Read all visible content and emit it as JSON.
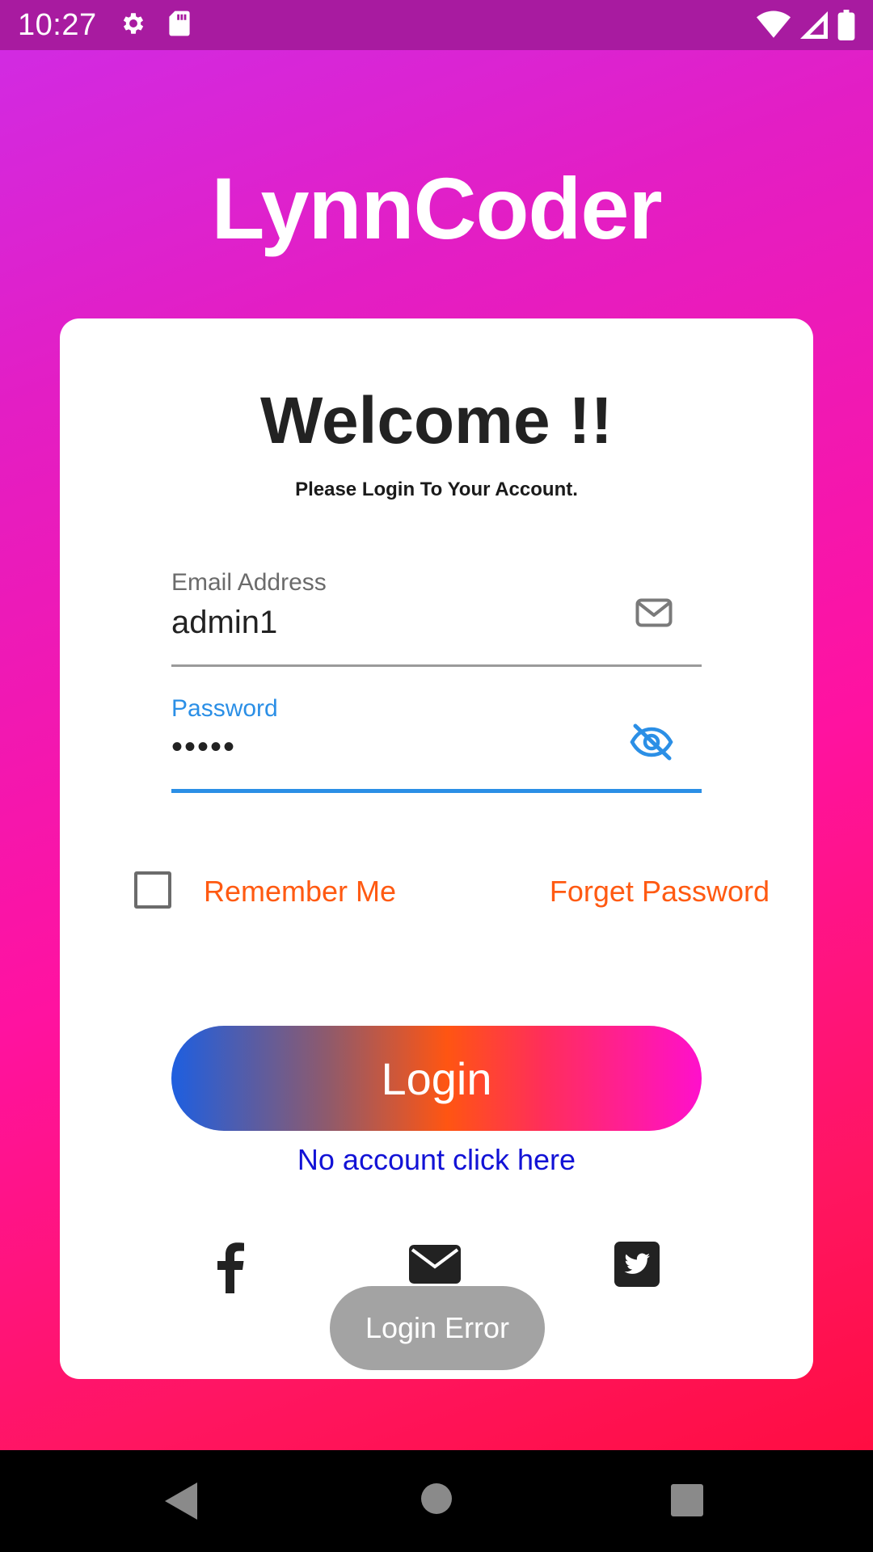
{
  "status_bar": {
    "time": "10:27",
    "icons_left": [
      "settings-icon",
      "sd-card-icon"
    ],
    "icons_right": [
      "wifi-icon",
      "signal-icon",
      "battery-icon"
    ],
    "color": "#a81ba0"
  },
  "app": {
    "title": "LynnCoder"
  },
  "card": {
    "welcome": "Welcome !!",
    "subtitle": "Please Login To Your Account."
  },
  "email": {
    "label": "Email Address",
    "value": "admin1",
    "icon": "envelope-outline-icon"
  },
  "password": {
    "label": "Password",
    "value": "•••••",
    "icon": "eye-slash-icon",
    "focused": true
  },
  "remember": {
    "label": "Remember Me",
    "checked": false
  },
  "forgot": {
    "label": "Forget Password"
  },
  "login_button": {
    "label": "Login"
  },
  "register_link": {
    "label": "No account click here"
  },
  "social": [
    "facebook-icon",
    "envelope-icon",
    "twitter-icon"
  ],
  "toast": {
    "message": "Login Error"
  },
  "colors": {
    "accent_orange": "#ff5a12",
    "focus_blue": "#2b8fe6",
    "link_blue": "#1212d6",
    "toast_gray": "#a3a3a3"
  },
  "nav_bar": {
    "buttons": [
      "back-icon",
      "home-icon",
      "recents-icon"
    ]
  }
}
